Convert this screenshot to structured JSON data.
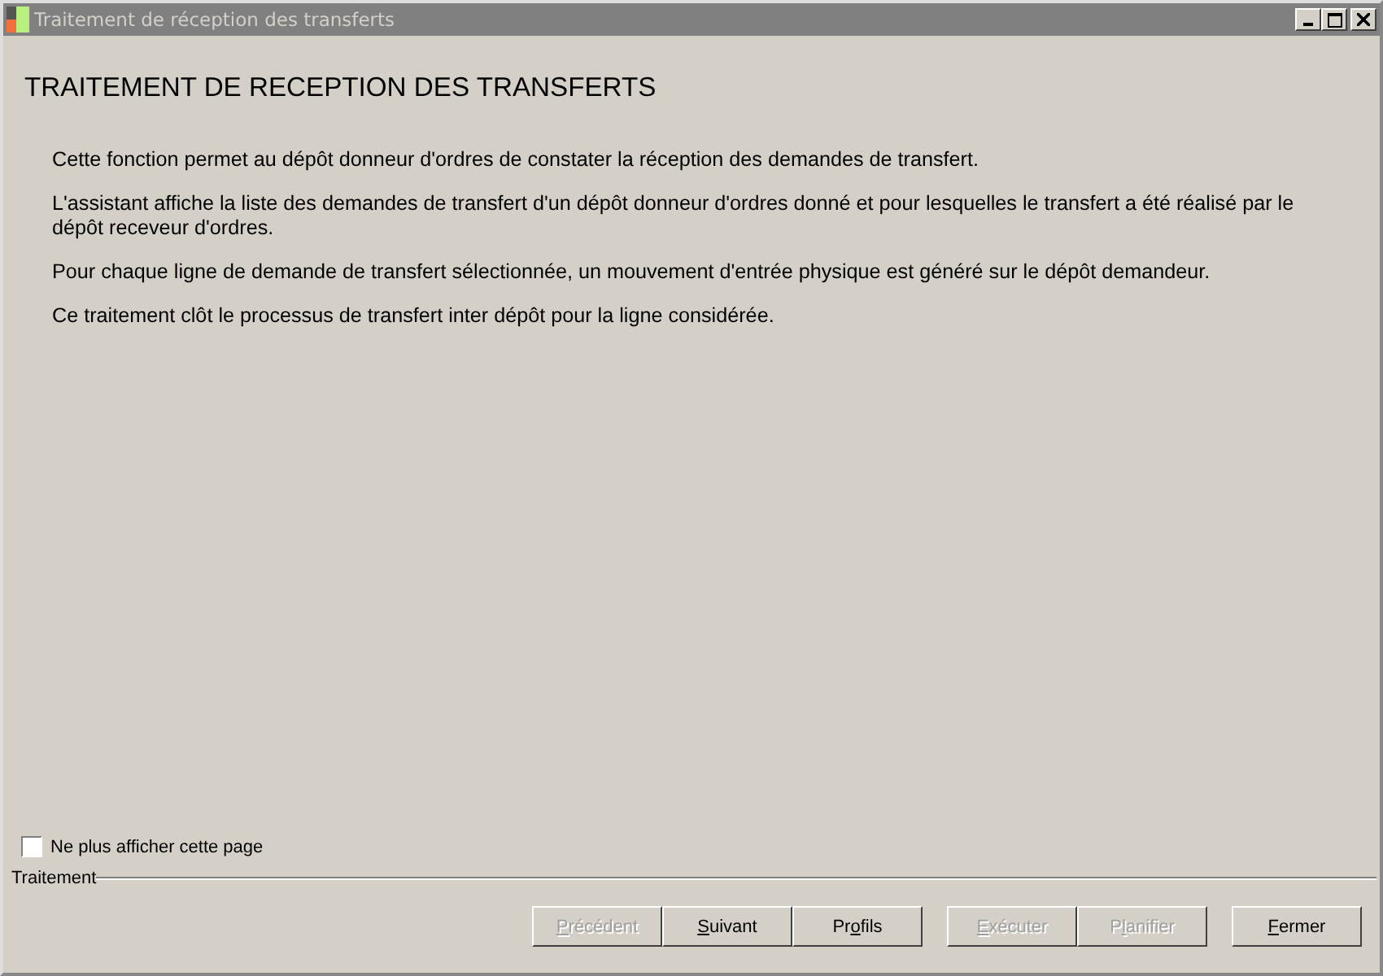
{
  "window": {
    "title": "Traitement de réception des transferts"
  },
  "heading": "TRAITEMENT DE RECEPTION DES TRANSFERTS",
  "paragraphs": [
    "Cette fonction permet au dépôt donneur d'ordres de constater la réception des demandes de transfert.",
    "L'assistant affiche la liste des demandes de transfert d'un dépôt donneur d'ordres donné et pour lesquelles le transfert a été réalisé par le dépôt receveur d'ordres.",
    "Pour chaque ligne de demande de transfert sélectionnée, un mouvement d'entrée physique est généré sur le dépôt demandeur.",
    "Ce traitement clôt le processus de transfert inter dépôt pour la ligne considérée."
  ],
  "dont_show": {
    "label": "Ne plus afficher cette page",
    "checked": false
  },
  "group_label": "Traitement",
  "button_groups": [
    [
      {
        "key": "P",
        "post": "récédent",
        "disabled": true
      },
      {
        "key": "S",
        "post": "uivant",
        "disabled": false
      },
      {
        "pre": "Pr",
        "key": "o",
        "post": "fils",
        "disabled": false
      }
    ],
    [
      {
        "key": "E",
        "post": "xécuter",
        "disabled": true
      },
      {
        "pre": "P",
        "key": "l",
        "post": "anifier",
        "disabled": true
      }
    ],
    [
      {
        "key": "F",
        "post": "ermer",
        "disabled": false
      }
    ]
  ]
}
